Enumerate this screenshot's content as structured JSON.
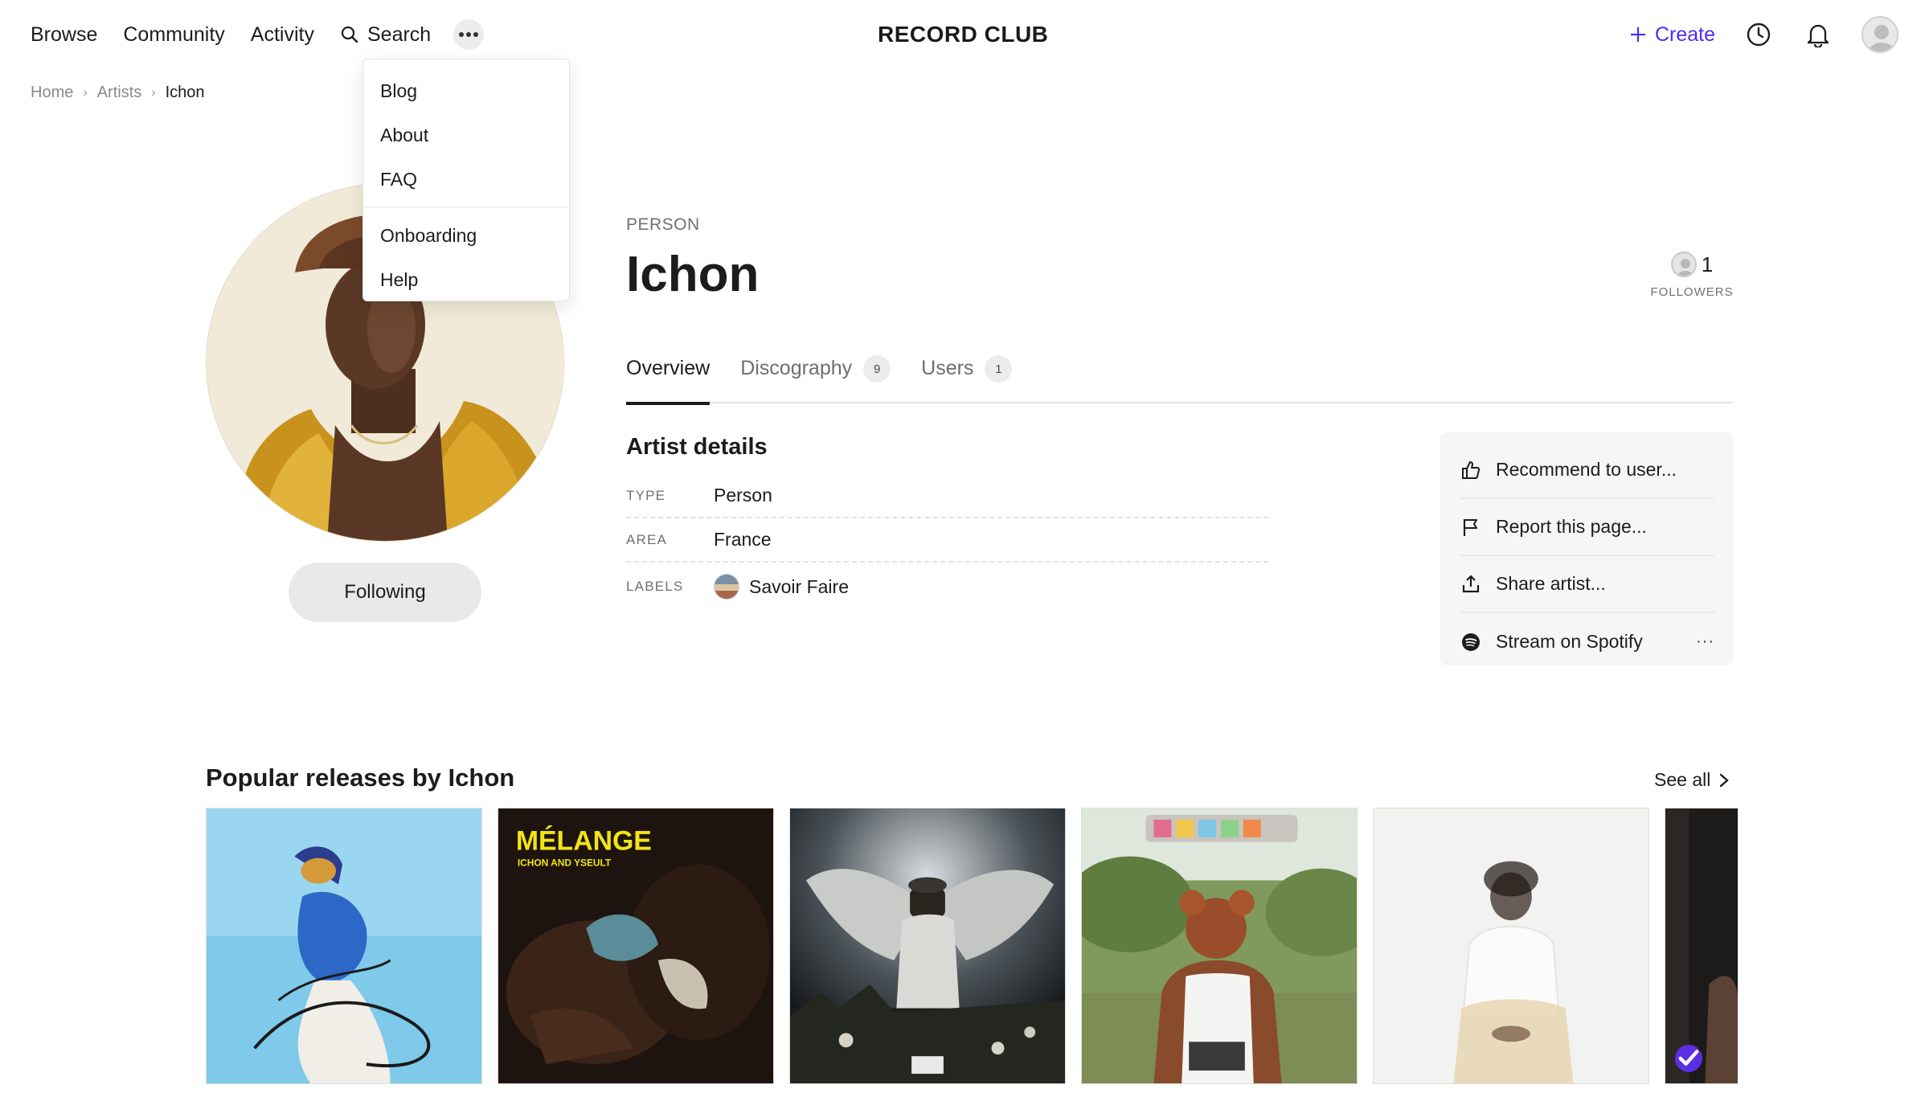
{
  "nav": {
    "links": [
      "Browse",
      "Community",
      "Activity"
    ],
    "search_label": "Search",
    "logo": "RECORD CLUB",
    "create_label": "Create",
    "accent_color": "#4b2cf5"
  },
  "dropdown": {
    "group1": [
      "Blog",
      "About",
      "FAQ"
    ],
    "group2": [
      "Onboarding",
      "Help"
    ]
  },
  "breadcrumb": {
    "items": [
      "Home",
      "Artists"
    ],
    "current": "Ichon"
  },
  "artist": {
    "kind": "PERSON",
    "name": "Ichon",
    "follow_label": "Following",
    "followers_count": "1",
    "followers_label": "FOLLOWERS"
  },
  "tabs": [
    {
      "label": "Overview",
      "count": null,
      "active": true
    },
    {
      "label": "Discography",
      "count": "9",
      "active": false
    },
    {
      "label": "Users",
      "count": "1",
      "active": false
    }
  ],
  "details": {
    "title": "Artist details",
    "rows": [
      {
        "key": "TYPE",
        "value": "Person"
      },
      {
        "key": "AREA",
        "value": "France"
      },
      {
        "key": "LABELS",
        "value": "Savoir Faire"
      }
    ]
  },
  "actions": {
    "items": [
      "Recommend to user...",
      "Report this page...",
      "Share artist...",
      "Stream on Spotify"
    ],
    "more": "···"
  },
  "releases": {
    "title": "Popular releases by Ichon",
    "see_all": "See all",
    "covers": [
      {
        "art": "blue-sky-dancer"
      },
      {
        "art": "melange-dark",
        "text": "MÉLANGE",
        "subtext": "ICHON AND YSEULT"
      },
      {
        "art": "winged-figure-night"
      },
      {
        "art": "park-portrait"
      },
      {
        "art": "blurred-white"
      },
      {
        "art": "partial-dark",
        "checked": true
      }
    ]
  }
}
